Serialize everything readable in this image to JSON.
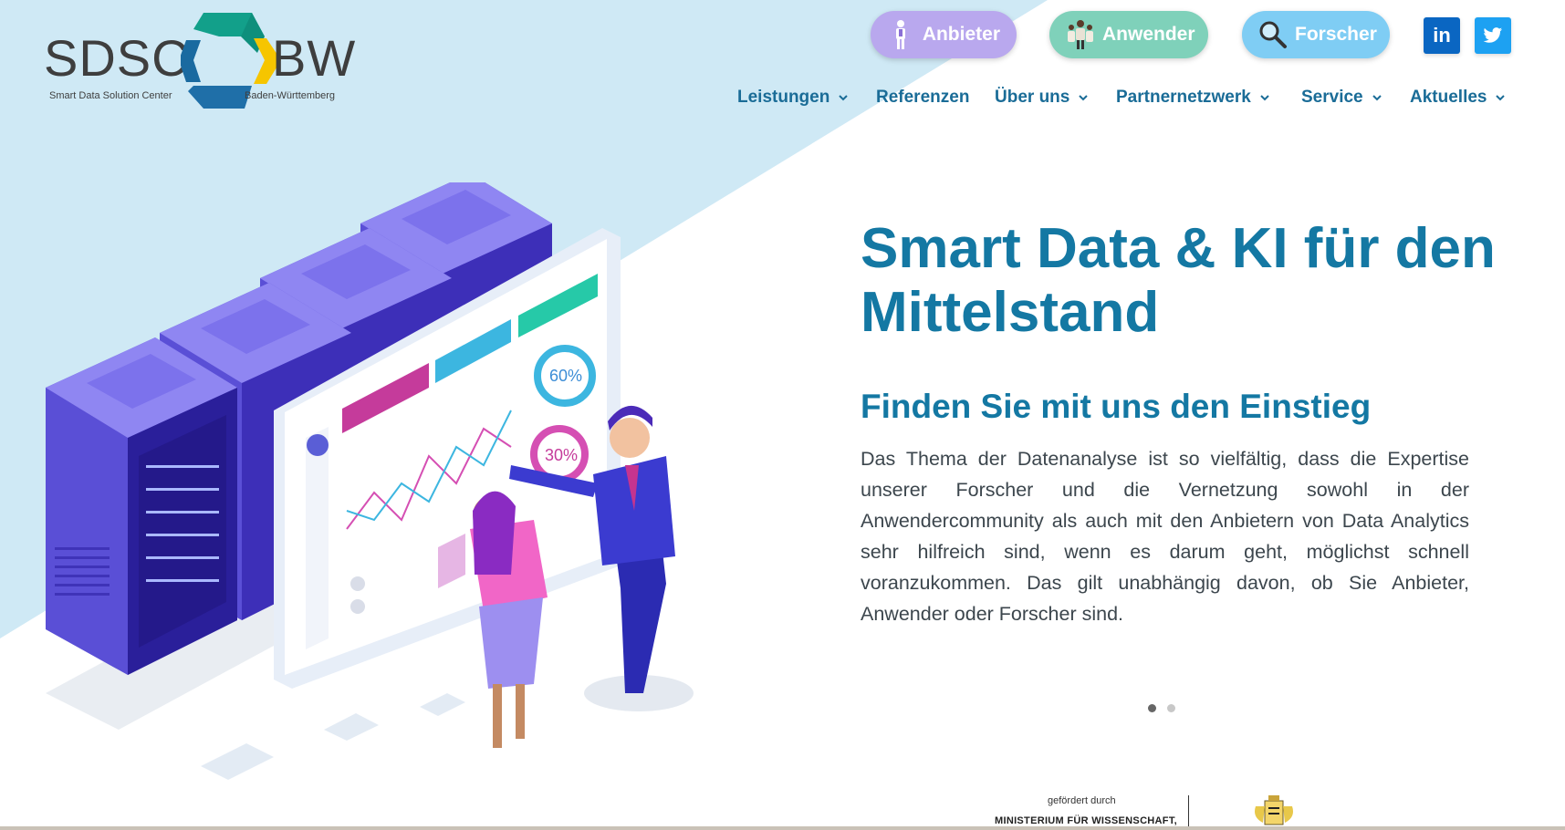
{
  "logo": {
    "left_text": "SDSC",
    "right_text": "BW",
    "left_sub": "Smart Data Solution Center",
    "right_sub": "Baden-Württemberg",
    "colors": {
      "teal": "#12a08a",
      "yellow": "#f6c500",
      "blue": "#1f6fa8",
      "text": "#3e3e3e"
    }
  },
  "roles": [
    {
      "label": "Anbieter",
      "icon": "provider-person-icon",
      "color": "#b9a8ee"
    },
    {
      "label": "Anwender",
      "icon": "users-group-icon",
      "color": "#7fd1ba"
    },
    {
      "label": "Forscher",
      "icon": "magnifier-icon",
      "color": "#7fcdf4"
    }
  ],
  "social": {
    "linkedin_label": "in",
    "linkedin_icon": "linkedin-icon",
    "twitter_icon": "twitter-icon"
  },
  "nav": [
    {
      "label": "Leistungen",
      "has_dropdown": true
    },
    {
      "label": "Referenzen",
      "has_dropdown": false
    },
    {
      "label": "Über uns",
      "has_dropdown": true
    },
    {
      "label": "Partnernetzwerk",
      "has_dropdown": true
    },
    {
      "label": "Service",
      "has_dropdown": true
    },
    {
      "label": "Aktuelles",
      "has_dropdown": true
    }
  ],
  "hero": {
    "title_line1": "Smart Data & KI für den",
    "title_line2": "Mittelstand",
    "subtitle": "Finden Sie mit uns den Einstieg",
    "body": "Das Thema der Datenanalyse ist so vielfältig, dass die Expertise unserer Forscher und die Vernetzung sowohl in der Anwendercommunity als auch mit den Anbietern von Data Analytics sehr hilfreich sind, wenn es darum geht, möglichst schnell voranzukommen. Das gilt unabhängig davon, ob Sie Anbieter, Anwender oder Forscher sind."
  },
  "slider": {
    "total": 2,
    "active": 1
  },
  "illustration": {
    "gauge_top": "60%",
    "gauge_bottom": "30%"
  },
  "funding": {
    "top": "gefördert durch",
    "bottom": "MINISTERIUM FÜR WISSENSCHAFT,"
  },
  "colors": {
    "brand_blue": "#1478a3",
    "nav_blue": "#1a6c97",
    "bg_wedge": "#cde9f5"
  }
}
